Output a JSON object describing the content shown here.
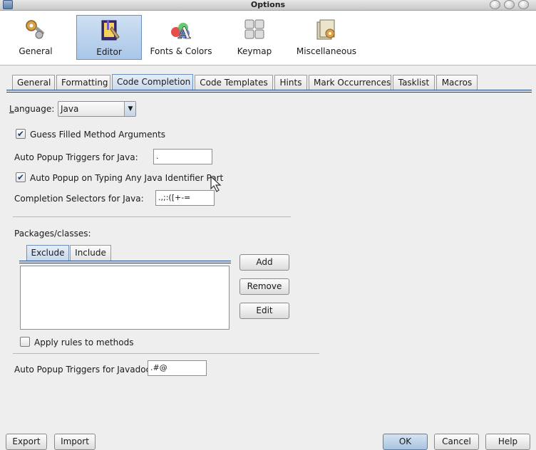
{
  "window": {
    "title": "Options"
  },
  "categories": [
    {
      "label": "General",
      "icon": "gears-icon",
      "selected": false
    },
    {
      "label": "Editor",
      "icon": "editor-book-icon",
      "selected": true
    },
    {
      "label": "Fonts & Colors",
      "icon": "fonts-colors-icon",
      "selected": false
    },
    {
      "label": "Keymap",
      "icon": "keymap-icon",
      "selected": false
    },
    {
      "label": "Miscellaneous",
      "icon": "miscellaneous-icon",
      "selected": false
    }
  ],
  "tabs": [
    "General",
    "Formatting",
    "Code Completion",
    "Code Templates",
    "Hints",
    "Mark Occurrences",
    "Tasklist",
    "Macros"
  ],
  "active_tab": "Code Completion",
  "language": {
    "label": "Language:",
    "value": "Java"
  },
  "guess_args": {
    "label": "Guess Filled Method Arguments",
    "checked": true
  },
  "popup_triggers": {
    "label": "Auto Popup Triggers for Java:",
    "value": "."
  },
  "popup_identifier": {
    "label": "Auto Popup on Typing Any Java Identifier Part",
    "checked": true
  },
  "completion_selectors": {
    "label": "Completion Selectors for Java:",
    "value": ".,;:([+-="
  },
  "packages": {
    "label": "Packages/classes:",
    "tabs": [
      "Exclude",
      "Include"
    ],
    "active_tab": "Exclude",
    "buttons": {
      "add": "Add",
      "remove": "Remove",
      "edit": "Edit"
    }
  },
  "apply_rules": {
    "label": "Apply rules to methods",
    "checked": false
  },
  "javadoc_triggers": {
    "label": "Auto Popup Triggers for Javadoc:",
    "value": ".#@"
  },
  "footer": {
    "export": "Export",
    "import": "Import",
    "ok": "OK",
    "cancel": "Cancel",
    "help": "Help"
  }
}
